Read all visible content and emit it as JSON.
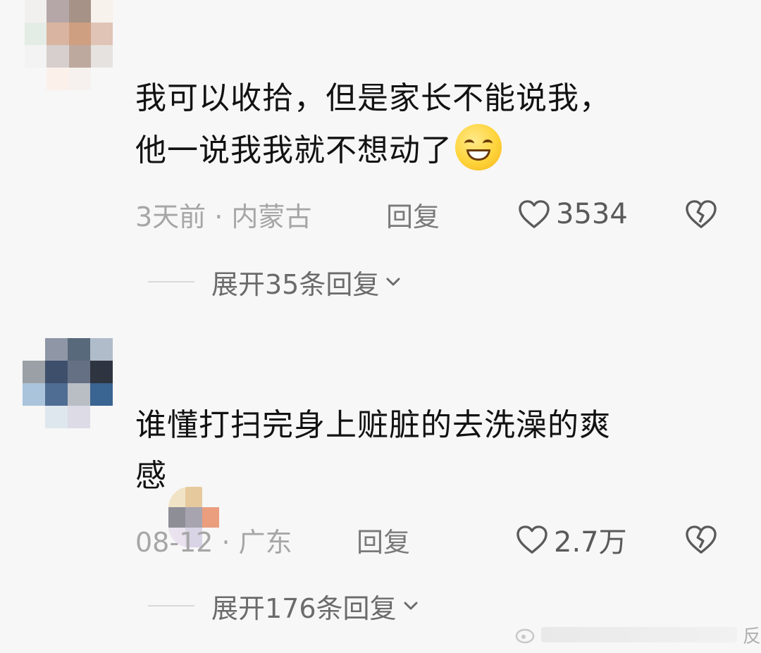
{
  "comments": [
    {
      "avatar_colors": [
        "#f2f0ee",
        "#b5a7a8",
        "#a69286",
        "#f8f2ec",
        "#e4ece6",
        "#d9b4a0",
        "#cf9f82",
        "#e0c4b6",
        "#f3f3f3",
        "#d7cfcd",
        "#bda99e",
        "#e5e2df",
        "#f7f7f7",
        "#fbf1ea",
        "#f6f1ee",
        "#f7f7f7",
        "#f7f7f7",
        "#f7f7f7",
        "#f7f7f7",
        "#f7f7f7"
      ],
      "text_line1": "我可以收拾，但是家长不能说我，",
      "text_line2": "他一说我我就不想动了",
      "emoji": "smile-emoji",
      "time_location": "3天前 · 内蒙古",
      "reply_label": "回复",
      "like_count": "3534",
      "expand_label": "展开35条回复"
    },
    {
      "avatar_colors": [
        "#f7f7f7",
        "#8f97a6",
        "#58697b",
        "#b0bcc9",
        "#9aa0a6",
        "#3e4f6c",
        "#667085",
        "#2e3440",
        "#aac4dc",
        "#4f6d92",
        "#b9bec5",
        "#3a6491",
        "#f7f7f7",
        "#dfe7ee",
        "#dcdbe6",
        "#f7f7f7"
      ],
      "text_line1": "谁懂打扫完身上赃脏的去洗澡的爽",
      "text_line2": "感",
      "emoji": "blurred-emoji",
      "emoji_colors": [
        "#f1e3c6",
        "#e6c99d",
        "#f7f7f7",
        "#8e8e96",
        "#a7a4b0",
        "#ea9e7e",
        "#eae3ef",
        "#d9d3e6",
        "#f7f7f7"
      ],
      "time_location": "08-12 · 广东",
      "reply_label": "回复",
      "like_count": "2.7万",
      "expand_label": "展开176条回复"
    }
  ],
  "watermark": {
    "text": "反"
  }
}
